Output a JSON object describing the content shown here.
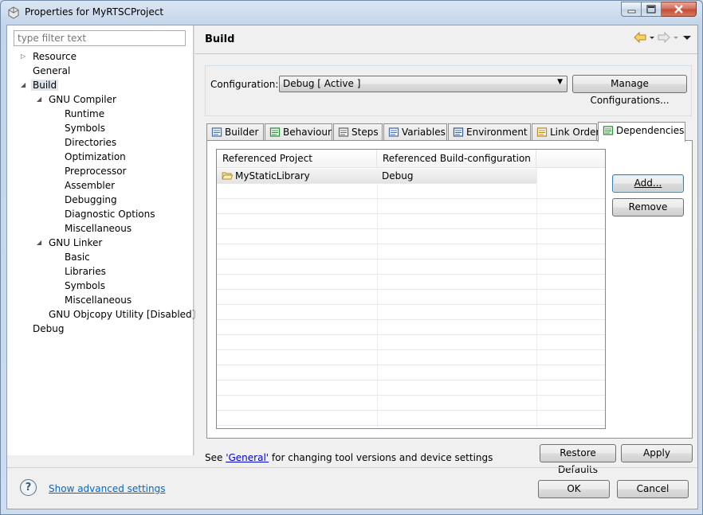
{
  "window": {
    "title": "Properties for MyRTSCProject"
  },
  "tree": {
    "filter_placeholder": "type filter text",
    "items": [
      {
        "label": "Resource",
        "level": 0,
        "twisty": "collapsed"
      },
      {
        "label": "General",
        "level": 0,
        "twisty": "none"
      },
      {
        "label": "Build",
        "level": 0,
        "twisty": "expanded",
        "selected": true
      },
      {
        "label": "GNU Compiler",
        "level": 1,
        "twisty": "expanded"
      },
      {
        "label": "Runtime",
        "level": 2,
        "twisty": "none"
      },
      {
        "label": "Symbols",
        "level": 2,
        "twisty": "none"
      },
      {
        "label": "Directories",
        "level": 2,
        "twisty": "none"
      },
      {
        "label": "Optimization",
        "level": 2,
        "twisty": "none"
      },
      {
        "label": "Preprocessor",
        "level": 2,
        "twisty": "none"
      },
      {
        "label": "Assembler",
        "level": 2,
        "twisty": "none"
      },
      {
        "label": "Debugging",
        "level": 2,
        "twisty": "none"
      },
      {
        "label": "Diagnostic Options",
        "level": 2,
        "twisty": "none"
      },
      {
        "label": "Miscellaneous",
        "level": 2,
        "twisty": "none"
      },
      {
        "label": "GNU Linker",
        "level": 1,
        "twisty": "expanded"
      },
      {
        "label": "Basic",
        "level": 2,
        "twisty": "none"
      },
      {
        "label": "Libraries",
        "level": 2,
        "twisty": "none"
      },
      {
        "label": "Symbols",
        "level": 2,
        "twisty": "none"
      },
      {
        "label": "Miscellaneous",
        "level": 2,
        "twisty": "none"
      },
      {
        "label": "GNU Objcopy Utility  [Disabled]",
        "level": 1,
        "twisty": "none"
      },
      {
        "label": "Debug",
        "level": 0,
        "twisty": "none"
      }
    ]
  },
  "page": {
    "title": "Build",
    "configuration_label": "Configuration:",
    "configuration_value": "Debug  [ Active ]",
    "manage_configurations": "Manage Configurations...",
    "tabs": [
      {
        "label": "Builder",
        "icon": "builder-icon"
      },
      {
        "label": "Behaviour",
        "icon": "behaviour-icon"
      },
      {
        "label": "Steps",
        "icon": "steps-icon"
      },
      {
        "label": "Variables",
        "icon": "variables-icon"
      },
      {
        "label": "Environment",
        "icon": "environment-icon"
      },
      {
        "label": "Link Order",
        "icon": "link-order-icon"
      },
      {
        "label": "Dependencies",
        "icon": "dependencies-icon",
        "active": true
      }
    ],
    "table": {
      "columns": [
        "Referenced Project",
        "Referenced Build-configuration"
      ],
      "rows": [
        {
          "project": "MyStaticLibrary",
          "config": "Debug"
        }
      ]
    },
    "add_button": "Add...",
    "remove_button": "Remove",
    "note_prefix": "See ",
    "note_link": "'General'",
    "note_suffix": " for changing tool versions and device settings",
    "restore_defaults": "Restore Defaults",
    "apply": "Apply"
  },
  "footer": {
    "advanced_link": "Show advanced settings",
    "ok": "OK",
    "cancel": "Cancel"
  }
}
